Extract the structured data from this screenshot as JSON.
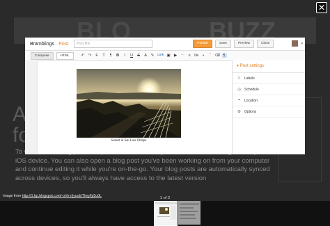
{
  "background_page": {
    "banner_left": "BLO",
    "banner_right": "BUZZ",
    "heading_line1": "A",
    "heading_line2": "fo",
    "paragraph": "To write a new blog post and publish it immediately or save it as a draft right from your iOS device. You can also open a blog post you've been working on from your computer and continue editing it while you're on-the-go. Your blog posts are automatically synced across devices, so you'll always have access to the latest version"
  },
  "close_icon": "close-icon",
  "editor": {
    "blog_name": "Bramblings",
    "separator": "·",
    "section": "Post",
    "title_placeholder": "Post title",
    "buttons": {
      "publish": "Publish",
      "save": "Save",
      "preview": "Preview",
      "close": "Close"
    },
    "modes": {
      "compose": "Compose",
      "html": "HTML"
    },
    "toolbar_icons": [
      "undo-icon",
      "redo-icon",
      "font-icon",
      "size-icon",
      "format-icon",
      "bold-icon",
      "italic-icon",
      "underline-icon",
      "strike-icon",
      "text-color-icon",
      "highlight-icon",
      "link-icon",
      "image-icon",
      "video-icon",
      "jump-break-icon",
      "align-icon",
      "numbered-list-icon",
      "bullet-list-icon",
      "quote-icon",
      "clear-format-icon",
      "rtl-icon"
    ],
    "toolbar_link_label": "Link",
    "caption": "Sunset in San Luis Obispo",
    "colors": {
      "accent": "#e67e22",
      "publish": "#f39c3c"
    }
  },
  "post_settings": {
    "title": "Post settings",
    "items": [
      {
        "label": "Labels",
        "icon": "tag-icon"
      },
      {
        "label": "Schedule",
        "icon": "clock-icon"
      },
      {
        "label": "Location",
        "icon": "pin-icon"
      },
      {
        "label": "Options",
        "icon": "gear-icon"
      }
    ]
  },
  "lightbox": {
    "source_prefix": "Image from",
    "source_url": "http://1.bp.blogspot.com/-oVo-r/jyuob/Tlwy/fp5u0L",
    "counter": "1 of 2"
  }
}
